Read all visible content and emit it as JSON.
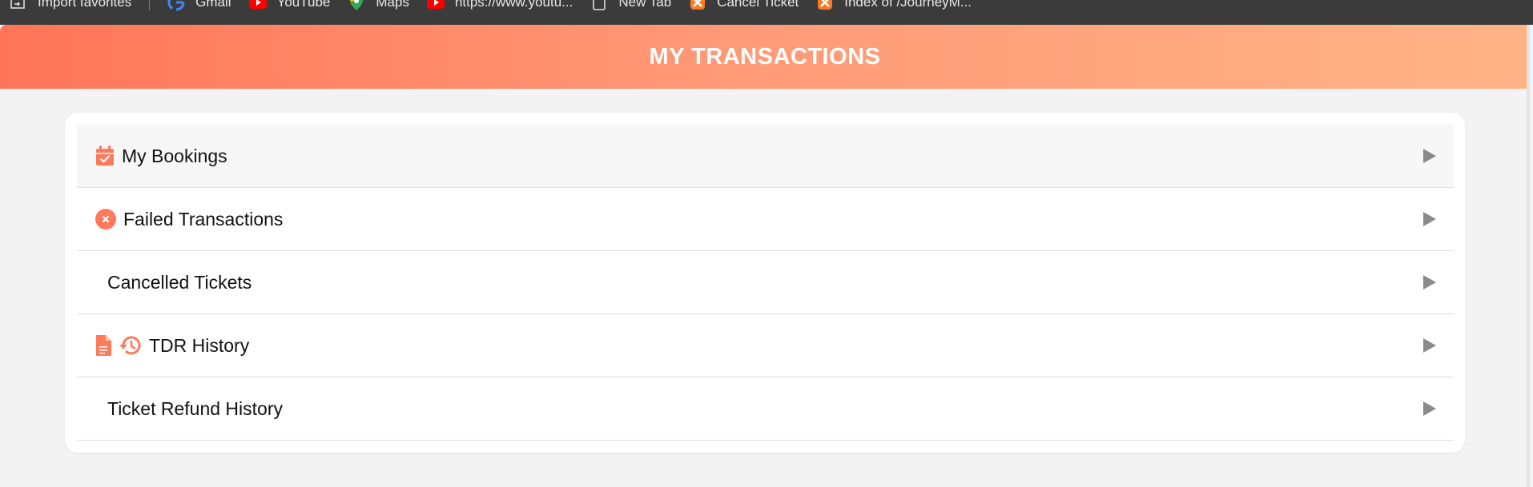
{
  "bookmarks": [
    {
      "label": "Import favorites",
      "icon": "import-icon"
    },
    {
      "label": "Gmail",
      "icon": "google-icon"
    },
    {
      "label": "YouTube",
      "icon": "youtube-icon"
    },
    {
      "label": "Maps",
      "icon": "maps-icon"
    },
    {
      "label": "https://www.youtu...",
      "icon": "youtube-icon"
    },
    {
      "label": "New Tab",
      "icon": "page-icon"
    },
    {
      "label": "Cancel Ticket",
      "icon": "xampp-icon"
    },
    {
      "label": "Index of /JourneyM...",
      "icon": "xampp-icon"
    }
  ],
  "header": {
    "title": "MY TRANSACTIONS"
  },
  "colors": {
    "accent": "#ff7a5c",
    "header_start": "#ff7558",
    "header_end": "#ffb386",
    "arrow": "#8a8a8a"
  },
  "menu": {
    "items": [
      {
        "label": "My Bookings",
        "icons": [
          "calendar-check-icon"
        ]
      },
      {
        "label": "Failed Transactions",
        "icons": [
          "x-circle-icon"
        ]
      },
      {
        "label": "Cancelled Tickets",
        "icons": []
      },
      {
        "label": "TDR History",
        "icons": [
          "document-icon",
          "history-icon"
        ]
      },
      {
        "label": "Ticket Refund History",
        "icons": []
      }
    ]
  }
}
